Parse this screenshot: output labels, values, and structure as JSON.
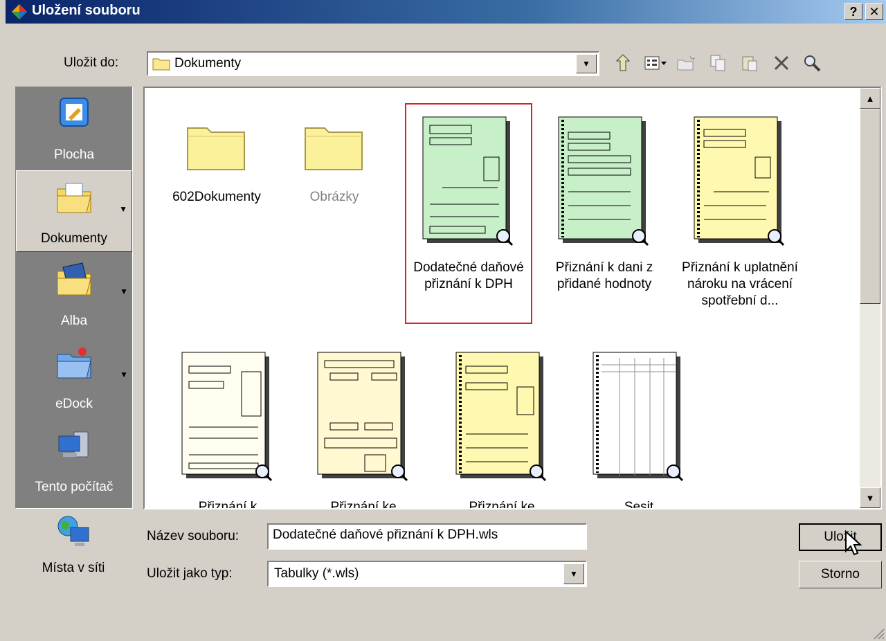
{
  "window": {
    "title": "Uložení souboru",
    "help_label": "?",
    "close_label": "✕"
  },
  "save_in": {
    "label": "Uložit do:",
    "value": "Dokumenty"
  },
  "toolbar": {
    "icons": [
      "up-folder-icon",
      "views-menu-icon",
      "new-folder-icon",
      "copy-icon",
      "paste-icon",
      "delete-icon",
      "search-icon"
    ]
  },
  "places": [
    {
      "label": "Plocha",
      "icon": "desktop-icon",
      "dropdown": false,
      "selected": false
    },
    {
      "label": "Dokumenty",
      "icon": "documents-folder-icon",
      "dropdown": true,
      "selected": true
    },
    {
      "label": "Alba",
      "icon": "albums-folder-icon",
      "dropdown": true,
      "selected": false
    },
    {
      "label": "eDock",
      "icon": "edock-folder-icon",
      "dropdown": true,
      "selected": false
    },
    {
      "label": "Tento počítač",
      "icon": "my-computer-icon",
      "dropdown": false,
      "selected": false
    },
    {
      "label": "Místa v síti",
      "icon": "network-places-icon",
      "dropdown": false,
      "selected": false
    }
  ],
  "files": [
    {
      "name": "602Dokumenty",
      "type": "folder",
      "dim": false
    },
    {
      "name": "Obrázky",
      "type": "folder",
      "dim": true
    },
    {
      "name": "Dodatečné daňové přiznání k DPH",
      "type": "form-green",
      "selected": true
    },
    {
      "name": "Přiznání k dani z přidané hodnoty",
      "type": "form-green"
    },
    {
      "name": "Přiznání k uplatnění nároku na vrácení spotřební d...",
      "type": "form-yellow"
    },
    {
      "name": "Přiznání k",
      "type": "form-white"
    },
    {
      "name": "Přiznání ke",
      "type": "form-cream"
    },
    {
      "name": "Přiznání ke",
      "type": "form-yellow"
    },
    {
      "name": "Sesit",
      "type": "sheet"
    }
  ],
  "filename": {
    "label": "Název souboru:",
    "value": "Dodatečné daňové přiznání k DPH.wls"
  },
  "filetype": {
    "label": "Uložit jako typ:",
    "value": "Tabulky (*.wls)"
  },
  "buttons": {
    "save": "Uložit",
    "cancel": "Storno"
  },
  "colors": {
    "titlebar_start": "#0a246a",
    "selection_border": "#e02020",
    "form_green": "#c8f0c8",
    "form_yellow": "#fff8b0"
  }
}
